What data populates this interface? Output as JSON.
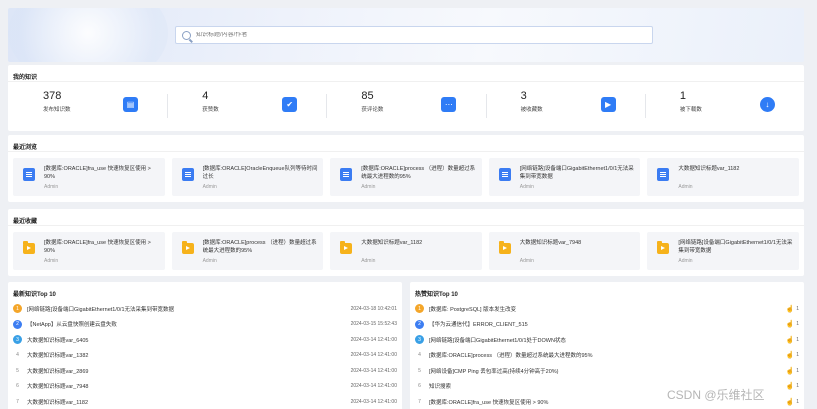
{
  "search": {
    "placeholder": "知识标题/内容/作者"
  },
  "my_knowledge": {
    "title": "我的知识",
    "stats": [
      {
        "value": "378",
        "label": "发布知识数",
        "icon": "document-icon"
      },
      {
        "value": "4",
        "label": "获赞数",
        "icon": "thumbs-up-icon"
      },
      {
        "value": "85",
        "label": "获评论数",
        "icon": "comment-icon"
      },
      {
        "value": "3",
        "label": "被收藏数",
        "icon": "folder-icon"
      },
      {
        "value": "1",
        "label": "被下载数",
        "icon": "download-icon"
      }
    ]
  },
  "recent_views": {
    "title": "最近浏览",
    "items": [
      {
        "title": "[数据库:ORACLE]fra_use 快速恢复区使用 > 90%",
        "author": "Admin"
      },
      {
        "title": "[数据库:ORACLE]OracleEnqueue队列等待时间过长",
        "author": "Admin"
      },
      {
        "title": "[数据库:ORACLE]process （进程）数量超过系统最大进程数的95%",
        "author": "Admin"
      },
      {
        "title": "[网络链路]设备端口GigabitEthernet1/0/1无法采集到带宽数据",
        "author": "Admin"
      },
      {
        "title": "大数据知识标题var_1182",
        "author": "Admin"
      }
    ]
  },
  "recent_favorites": {
    "title": "最近收藏",
    "items": [
      {
        "title": "[数据库:ORACLE]fra_use 快速恢复区使用 > 90%",
        "author": "Admin"
      },
      {
        "title": "[数据库:ORACLE]process （进程）数量超过系统最大进程数的95%",
        "author": "Admin"
      },
      {
        "title": "大数据知识标题var_1182",
        "author": "Admin"
      },
      {
        "title": "大数据知识标题var_7948",
        "author": "Admin"
      },
      {
        "title": "[网络链路]设备端口GigabitEthernet1/0/1无法采集到带宽数据",
        "author": "Admin"
      }
    ]
  },
  "latest_top10": {
    "title": "最新知识Top 10",
    "rows": [
      {
        "rank": "1",
        "title": "[网络链路]设备端口GigabitEthernet1/0/1无法采集到带宽数据",
        "date": "2024-03-18 10:42:01"
      },
      {
        "rank": "2",
        "title": "【NetApp】从云盘快照创建云盘失败",
        "date": "2024-03-15 15:52:43"
      },
      {
        "rank": "3",
        "title": "大数据知识标题var_6405",
        "date": "2024-03-14 12:41:00"
      },
      {
        "rank": "4",
        "title": "大数据知识标题var_1382",
        "date": "2024-03-14 12:41:00"
      },
      {
        "rank": "5",
        "title": "大数据知识标题var_2869",
        "date": "2024-03-14 12:41:00"
      },
      {
        "rank": "6",
        "title": "大数据知识标题var_7948",
        "date": "2024-03-14 12:41:00"
      },
      {
        "rank": "7",
        "title": "大数据知识标题var_1182",
        "date": "2024-03-14 12:41:00"
      }
    ]
  },
  "hot_top10": {
    "title": "热赞知识Top 10",
    "rows": [
      {
        "rank": "1",
        "title": "[数据库: PostgreSQL] 版本发生改变",
        "likes": "1"
      },
      {
        "rank": "2",
        "title": "【华为云通信代】ERROR_CLIENT_515",
        "likes": "1"
      },
      {
        "rank": "3",
        "title": "[网络链路]设备端口GigabitEthernet1/0/1处于DOWN状态",
        "likes": "1"
      },
      {
        "rank": "4",
        "title": "[数据库:ORACLE]process （进程）数量超过系统最大进程数的95%",
        "likes": "1"
      },
      {
        "rank": "5",
        "title": "[网络设备]CMP Ping 丢包率过高(持续4分钟高于20%)",
        "likes": "1"
      },
      {
        "rank": "6",
        "title": "知识搜索",
        "likes": "1"
      },
      {
        "rank": "7",
        "title": "[数据库:ORACLE]fra_use 快速恢复区使用 > 90%",
        "likes": "1"
      }
    ]
  },
  "watermark": "CSDN @乐维社区",
  "colors": {
    "primary": "#2f7cf6",
    "folder": "#f6b21b",
    "rank1": "#f4a62a",
    "rank2": "#3d7ef2",
    "rank3": "#39a0e6"
  }
}
